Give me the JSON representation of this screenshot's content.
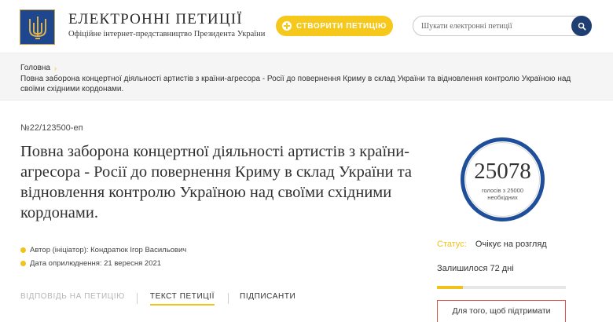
{
  "header": {
    "title": "ЕЛЕКТРОННІ ПЕТИЦІЇ",
    "subtitle": "Офіційне інтернет-представництво Президента України",
    "create_button": "СТВОРИТИ ПЕТИЦІЮ",
    "search_placeholder": "Шукати електронні петиції"
  },
  "breadcrumb": {
    "home": "Головна",
    "current": "Повна заборона концертної діяльності артистів з країни-агресора - Росії до повернення Криму в склад України та відновлення контролю Україною над своїми східними кордонами."
  },
  "petition": {
    "number": "№22/123500-еп",
    "title": "Повна заборона концертної діяльності артистів з країни-агресора - Росії до повернення Криму в склад України та відновлення контролю Україною над своїми східними кордонами.",
    "author": "Автор (ініціатор): Кондратюк Ігор Васильович",
    "date": "Дата оприлюднення: 21 вересня 2021"
  },
  "tabs": {
    "answer": "ВІДПОВІДЬ НА ПЕТИЦІЮ",
    "text": "ТЕКСТ ПЕТИЦІЇ",
    "signers": "ПІДПИСАНТИ"
  },
  "sidebar": {
    "votes": "25078",
    "votes_note": "голосів з 25000 необхідних",
    "status_label": "Статус:",
    "status_value": "Очікує на розгляд",
    "remaining": "Залишилося 72 дні",
    "progress_fraction": 0.2,
    "support_button": "Для того, щоб підтримати"
  },
  "colors": {
    "accent": "#f0c21a",
    "brand_blue": "#1f4f9a",
    "button_red_border": "#d9534f"
  },
  "icons": [
    "trident-logo-icon",
    "plus-icon",
    "search-icon",
    "arrow-right-icon",
    "bullet-icon"
  ]
}
